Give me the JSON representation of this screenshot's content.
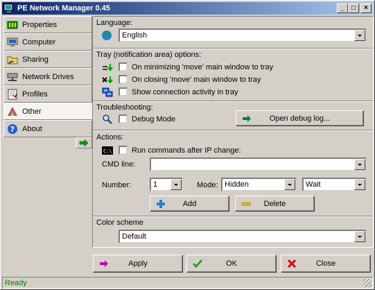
{
  "window": {
    "title": "PE Network Manager 0.45",
    "controls": [
      "_",
      "□",
      "×"
    ]
  },
  "sidebar": {
    "items": [
      {
        "label": "Properties",
        "icon": "properties-icon"
      },
      {
        "label": "Computer",
        "icon": "computer-icon"
      },
      {
        "label": "Sharing",
        "icon": "sharing-icon"
      },
      {
        "label": "Network Drives",
        "icon": "network-drives-icon"
      },
      {
        "label": "Profiles",
        "icon": "profiles-icon"
      },
      {
        "label": "Other",
        "icon": "other-icon",
        "active": true
      },
      {
        "label": "About",
        "icon": "about-icon"
      }
    ]
  },
  "language": {
    "label": "Language:",
    "value": "English"
  },
  "tray": {
    "label": "Tray (notification area) options:",
    "options": [
      {
        "label": "On minimizing 'move' main window to tray",
        "checked": false
      },
      {
        "label": "On closing 'move' main window to tray",
        "checked": false
      },
      {
        "label": "Show connection activity in tray",
        "checked": false
      }
    ]
  },
  "troubleshooting": {
    "label": "Troubleshooting:",
    "debug_label": "Debug Mode",
    "debug_checked": false,
    "open_log_button": "Open debug log..."
  },
  "actions": {
    "label": "Actions:",
    "run_commands_label": "Run commands after IP change:",
    "run_commands_checked": false,
    "cmd_line_label": "CMD line:",
    "cmd_line_value": "",
    "number_label": "Number:",
    "number_value": "1",
    "mode_label": "Mode:",
    "mode_value": "Hidden",
    "wait_value": "Wait",
    "add_button": "Add",
    "delete_button": "Delete"
  },
  "color_scheme": {
    "label": "Color scheme",
    "value": "Default"
  },
  "footer": {
    "apply": "Apply",
    "ok": "OK",
    "close": "Close"
  },
  "status": {
    "text": "Ready"
  },
  "colors": {
    "title_start": "#0a246a",
    "title_end": "#a6caf0",
    "status_text": "#008000",
    "face": "#d4d0c8"
  }
}
